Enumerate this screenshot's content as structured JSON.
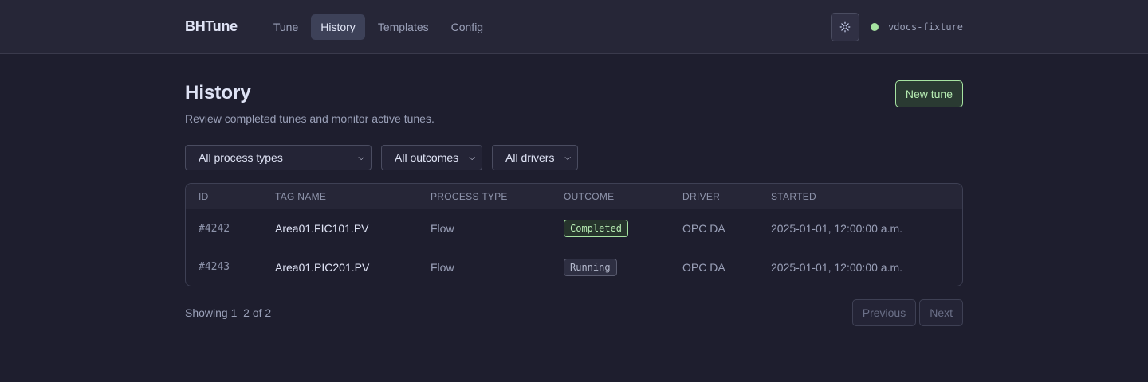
{
  "app": {
    "brand": "BHTune",
    "connection": "vdocs-fixture"
  },
  "nav": [
    {
      "label": "Tune",
      "active": false
    },
    {
      "label": "History",
      "active": true
    },
    {
      "label": "Templates",
      "active": false
    },
    {
      "label": "Config",
      "active": false
    }
  ],
  "page": {
    "title": "History",
    "subtitle": "Review completed tunes and monitor active tunes.",
    "new_button": "New tune"
  },
  "filters": {
    "process_type": "All process types",
    "outcome": "All outcomes",
    "driver": "All drivers"
  },
  "table": {
    "headers": [
      "ID",
      "TAG NAME",
      "PROCESS TYPE",
      "OUTCOME",
      "DRIVER",
      "STARTED"
    ],
    "rows": [
      {
        "id": "#4242",
        "tag": "Area01.FIC101.PV",
        "process_type": "Flow",
        "outcome": "Completed",
        "driver": "OPC DA",
        "started": "2025-01-01, 12:00:00 a.m."
      },
      {
        "id": "#4243",
        "tag": "Area01.PIC201.PV",
        "process_type": "Flow",
        "outcome": "Running",
        "driver": "OPC DA",
        "started": "2025-01-01, 12:00:00 a.m."
      }
    ]
  },
  "pagination": {
    "showing": "Showing 1–2 of 2",
    "previous": "Previous",
    "next": "Next"
  },
  "colors": {
    "accent": "#a6e3a1",
    "background": "#1e1e2e"
  },
  "icons": {
    "theme": "sun-icon",
    "select": "chevron-down-icon"
  }
}
